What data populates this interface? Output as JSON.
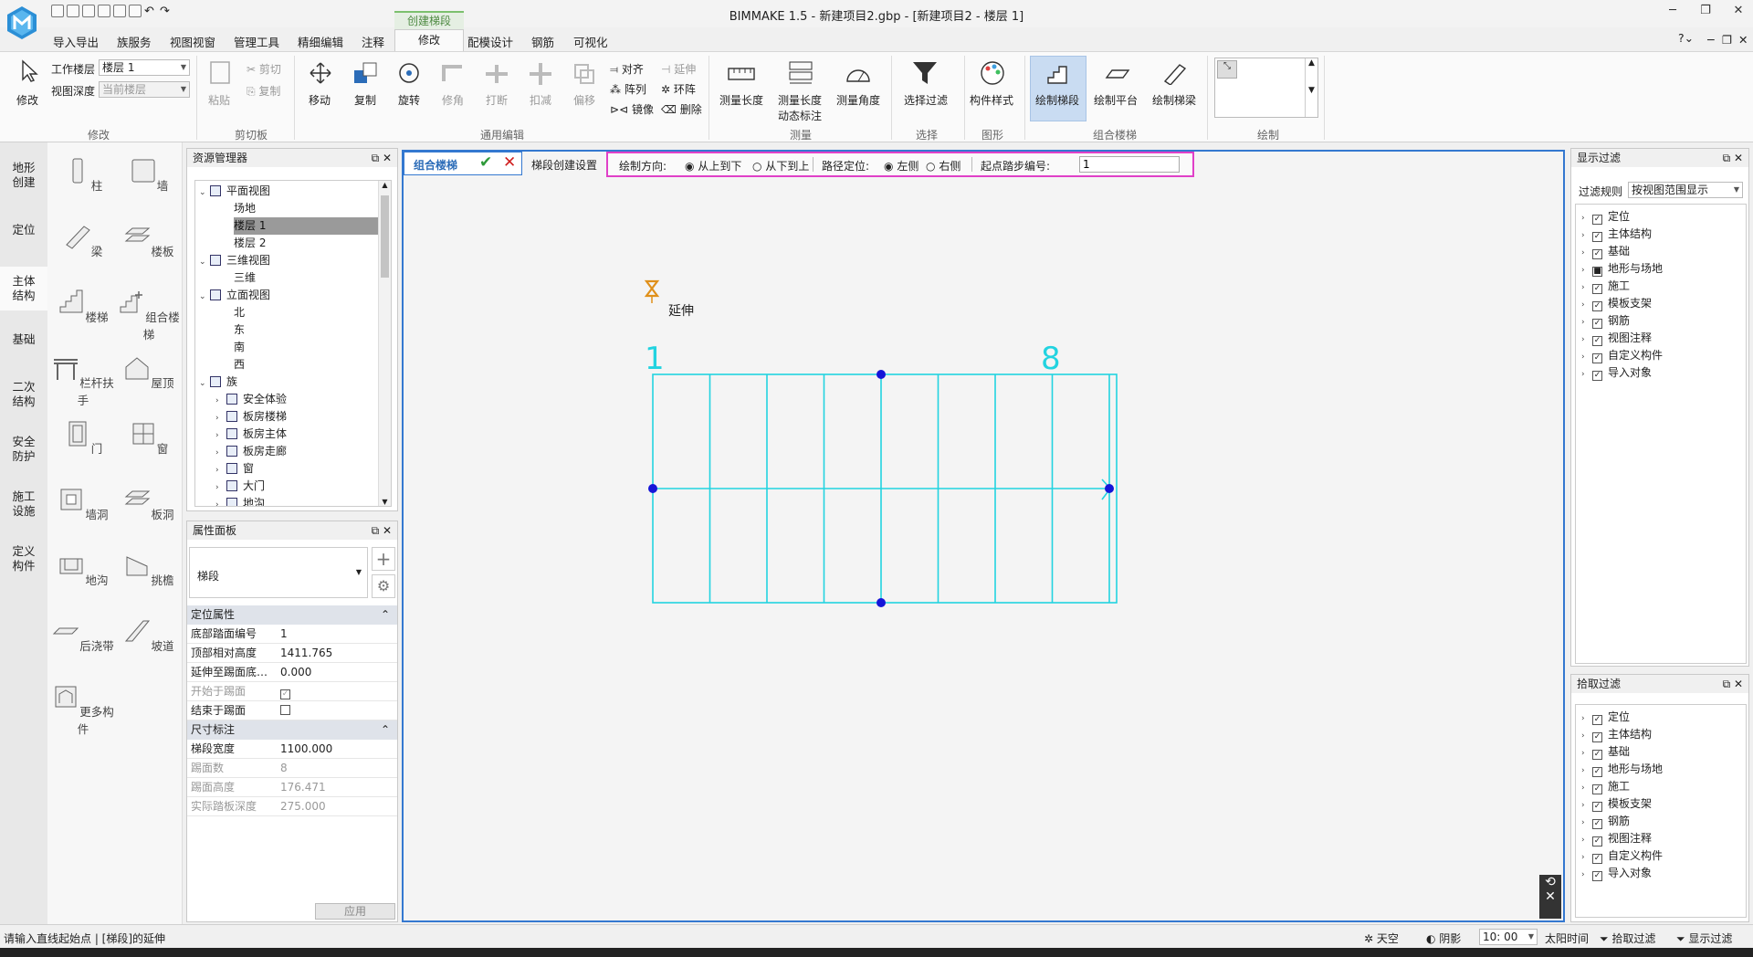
{
  "window": {
    "title": "BIMMAKE 1.5 - 新建项目2.gbp - [新建项目2 - 楼层 1]",
    "context_tab": "创建梯段"
  },
  "menu": [
    "导入导出",
    "族服务",
    "视图视窗",
    "管理工具",
    "精细编辑",
    "注释",
    "修改",
    "配模设计",
    "钢筋",
    "可视化"
  ],
  "ribbon": {
    "modify": {
      "label": "修改",
      "work_floor_label": "工作楼层",
      "work_floor_value": "楼层 1",
      "view_depth_label": "视图深度",
      "view_depth_value": "当前楼层",
      "group": "修改"
    },
    "clipboard": {
      "paste": "粘贴",
      "cut": "剪切",
      "copy": "复制",
      "group": "剪切板"
    },
    "edit": {
      "move": "移动",
      "copy": "复制",
      "rotate": "旋转",
      "corner": "修角",
      "break": "打断",
      "deduct": "扣减",
      "offset": "偏移",
      "align": "对齐",
      "array": "阵列",
      "mirror": "镜像",
      "extend": "延伸",
      "ring": "环阵",
      "delete": "删除",
      "group": "通用编辑"
    },
    "measure": {
      "length": "测量长度",
      "length_dyn_1": "测量长度",
      "length_dyn_2": "动态标注",
      "angle": "测量角度",
      "group": "测量"
    },
    "select": {
      "filter": "选择过滤",
      "group": "选择"
    },
    "graphic": {
      "style": "构件样式",
      "group": "图形"
    },
    "stair": {
      "draw_flight": "绘制梯段",
      "draw_platform": "绘制平台",
      "draw_beam": "绘制梯梁",
      "group": "组合楼梯"
    },
    "draw": {
      "group": "绘制"
    }
  },
  "left_categories": [
    "地形\n创建",
    "定位",
    "主体\n结构",
    "基础",
    "二次\n结构",
    "安全\n防护",
    "施工\n设施",
    "定义\n构件"
  ],
  "components": [
    "柱",
    "墙",
    "梁",
    "楼板",
    "楼梯",
    "组合楼梯",
    "栏杆扶手",
    "屋顶",
    "门",
    "窗",
    "墙洞",
    "板洞",
    "地沟",
    "挑檐",
    "后浇带",
    "坡道",
    "更多构件"
  ],
  "resource": {
    "title": "资源管理器",
    "tree": [
      {
        "t": "平面视图",
        "lvl": 0,
        "exp": "⌄",
        "ico": true
      },
      {
        "t": "场地",
        "lvl": 1
      },
      {
        "t": "楼层 1",
        "lvl": 1,
        "sel": true
      },
      {
        "t": "楼层 2",
        "lvl": 1
      },
      {
        "t": "三维视图",
        "lvl": 0,
        "exp": "⌄",
        "ico": true
      },
      {
        "t": "三维",
        "lvl": 1
      },
      {
        "t": "立面视图",
        "lvl": 0,
        "exp": "⌄",
        "ico": true
      },
      {
        "t": "北",
        "lvl": 1
      },
      {
        "t": "东",
        "lvl": 1
      },
      {
        "t": "南",
        "lvl": 1
      },
      {
        "t": "西",
        "lvl": 1
      },
      {
        "t": "族",
        "lvl": 0,
        "exp": "⌄",
        "ico": true
      },
      {
        "t": "安全体验",
        "lvl": 1,
        "exp": "›",
        "ico": true
      },
      {
        "t": "板房楼梯",
        "lvl": 1,
        "exp": "›",
        "ico": true
      },
      {
        "t": "板房主体",
        "lvl": 1,
        "exp": "›",
        "ico": true
      },
      {
        "t": "板房走廊",
        "lvl": 1,
        "exp": "›",
        "ico": true
      },
      {
        "t": "窗",
        "lvl": 1,
        "exp": "›",
        "ico": true
      },
      {
        "t": "大门",
        "lvl": 1,
        "exp": "›",
        "ico": true
      },
      {
        "t": "地沟",
        "lvl": 1,
        "exp": "›",
        "ico": true
      }
    ]
  },
  "properties": {
    "title": "属性面板",
    "type": "梯段",
    "sec1": "定位属性",
    "rows1": [
      {
        "k": "底部踏面编号",
        "v": "1"
      },
      {
        "k": "顶部相对高度",
        "v": "1411.765"
      },
      {
        "k": "延伸至踢面底…",
        "v": "0.000"
      },
      {
        "k": "开始于踢面",
        "v": "",
        "chk": true,
        "dis": true
      },
      {
        "k": "结束于踢面",
        "v": "",
        "chk": false
      }
    ],
    "sec2": "尺寸标注",
    "rows2": [
      {
        "k": "梯段宽度",
        "v": "1100.000"
      },
      {
        "k": "踢面数",
        "v": "8",
        "dis": true
      },
      {
        "k": "踢面高度",
        "v": "176.471",
        "dis": true
      },
      {
        "k": "实际踏板深度",
        "v": "275.000",
        "dis": true
      }
    ],
    "apply": "应用"
  },
  "canvas": {
    "tab": "组合楼梯",
    "settings": "梯段创建设置",
    "dir_label": "绘制方向:",
    "dir_opt1": "从上到下",
    "dir_opt2": "从下到上",
    "path_label": "路径定位:",
    "path_opt1": "左侧",
    "path_opt2": "右侧",
    "start_label": "起点踏步编号:",
    "start_value": "1",
    "extend_label": "延伸",
    "num_start": "1",
    "num_end": "8"
  },
  "display_filter": {
    "title": "显示过滤",
    "rule_label": "过滤规则",
    "rule_value": "按视图范围显示",
    "items": [
      "定位",
      "主体结构",
      "基础",
      "地形与场地",
      "施工",
      "模板支架",
      "钢筋",
      "视图注释",
      "自定义构件",
      "导入对象"
    ]
  },
  "pick_filter": {
    "title": "拾取过滤",
    "items": [
      "定位",
      "主体结构",
      "基础",
      "地形与场地",
      "施工",
      "模板支架",
      "钢筋",
      "视图注释",
      "自定义构件",
      "导入对象"
    ]
  },
  "status": {
    "prompt": "请输入直线起始点 | [梯段]的延伸",
    "sky": "天空",
    "shadow": "阴影",
    "time": "10: 00",
    "sun": "太阳时间",
    "pick": "拾取过滤",
    "display": "显示过滤"
  },
  "colors": {
    "accent": "#3478d0",
    "stair": "#22d3e0",
    "highlight": "#e040c8"
  }
}
